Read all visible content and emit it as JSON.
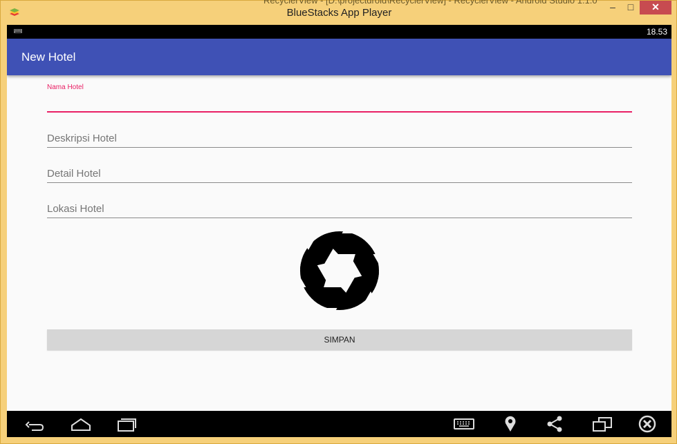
{
  "window": {
    "title": "BlueStacks App Player",
    "background_title": "RecyclerView - [D:\\projectdroid\\RecyclerView] - RecyclerView - Android Studio 1.1.0",
    "minimize_glyph": "–",
    "maximize_glyph": "□",
    "close_glyph": "✕"
  },
  "status_bar": {
    "time": "18.53"
  },
  "app_bar": {
    "title": "New Hotel"
  },
  "form": {
    "nama_hotel": {
      "label": "Nama Hotel",
      "value": ""
    },
    "deskripsi_hotel": {
      "placeholder": "Deskripsi Hotel"
    },
    "detail_hotel": {
      "placeholder": "Detail Hotel"
    },
    "lokasi_hotel": {
      "placeholder": "Lokasi Hotel"
    },
    "submit_label": "SIMPAN"
  },
  "icons": {
    "camera": "camera-shutter-icon",
    "back": "back-icon",
    "home": "home-icon",
    "recents": "recent-apps-icon",
    "keyboard": "keyboard-icon",
    "location": "location-pin-icon",
    "share": "share-icon",
    "rotate": "screen-rotate-icon",
    "exit": "close-circle-icon"
  },
  "colors": {
    "primary": "#3f51b5",
    "accent": "#e91e63"
  }
}
